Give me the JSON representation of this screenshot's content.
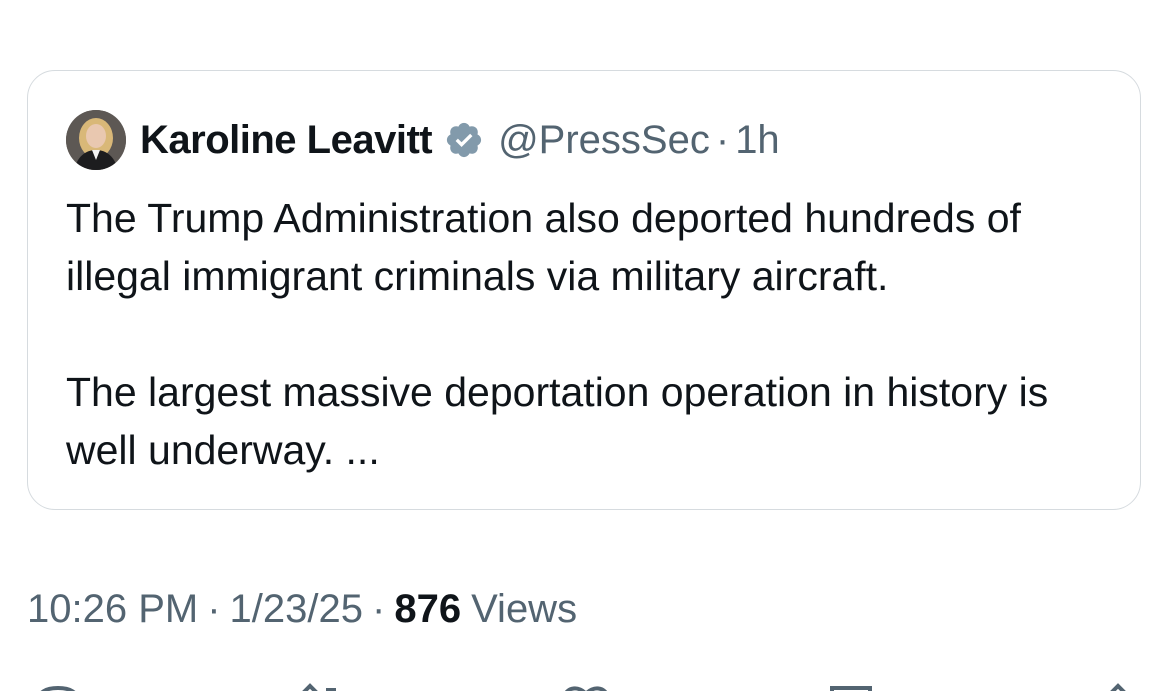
{
  "quoted_post": {
    "author_name": "Karoline Leavitt",
    "handle": "@PressSec",
    "separator": "·",
    "age": "1h",
    "verified": true,
    "paragraphs": [
      "The Trump Administration also deported hundreds of illegal immigrant criminals via military aircraft.",
      "The largest massive deportation operation in history is well underway. ..."
    ]
  },
  "post_meta": {
    "time": "10:26 PM",
    "separator": "·",
    "date": "1/23/25",
    "view_count": "876",
    "views_label": "Views"
  },
  "actions": [
    "reply-icon",
    "repost-icon",
    "like-icon",
    "bookmark-icon",
    "share-icon"
  ],
  "colors": {
    "text_primary": "#0f1419",
    "text_secondary": "#536471",
    "card_border": "#d6dbdf",
    "verified_badge": "#829aab"
  }
}
